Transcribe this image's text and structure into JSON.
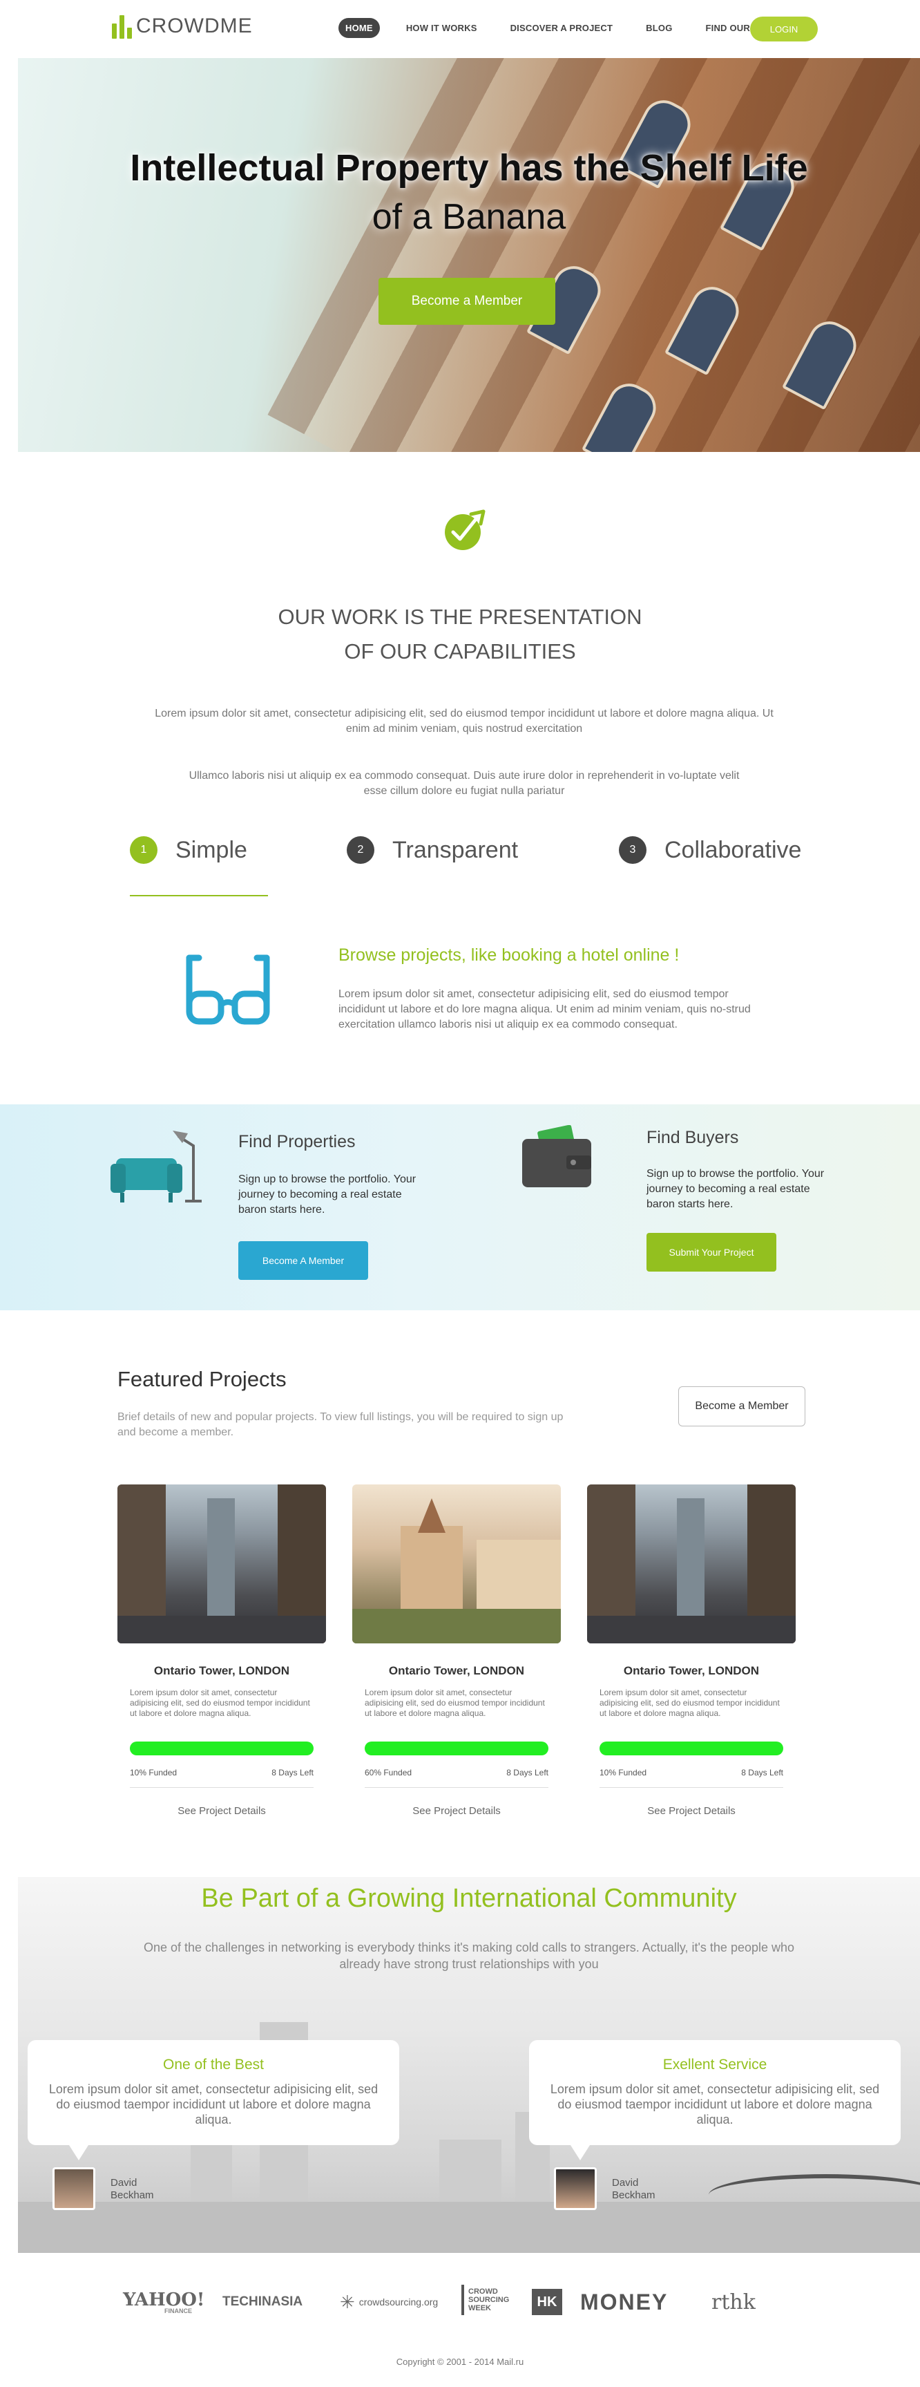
{
  "header": {
    "logo_text": "CROWDME",
    "nav": [
      "HOME",
      "HOW IT WORKS",
      "DISCOVER A PROJECT",
      "BLOG",
      "FIND OUR MORE"
    ],
    "login_label": "LOGIN"
  },
  "hero": {
    "title_line1": "Intellectual Property has the Shelf Life",
    "title_line2": "of a Banana",
    "cta_label": "Become a Member"
  },
  "work": {
    "title_line1": "OUR WORK IS THE PRESENTATION",
    "title_line2": "OF OUR CAPABILITIES",
    "paragraph1": "Lorem ipsum dolor sit amet, consectetur adipisicing elit, sed do eiusmod tempor incididunt ut labore et dolore magna aliqua. Ut enim ad minim veniam, quis nostrud exercitation",
    "paragraph2": "Ullamco laboris nisi ut aliquip ex ea commodo consequat. Duis aute irure dolor in reprehenderit in vo-luptate velit esse cillum dolore eu fugiat nulla pariatur",
    "steps": [
      {
        "num": "1",
        "label": "Simple",
        "color": "#93c01f"
      },
      {
        "num": "2",
        "label": "Transparent",
        "color": "#444444"
      },
      {
        "num": "3",
        "label": "Collaborative",
        "color": "#444444"
      }
    ],
    "browse_title": "Browse projects, like booking a hotel online !",
    "browse_text": "Lorem ipsum dolor sit amet, consectetur adipisicing elit, sed do eiusmod tempor incididunt ut labore et do lore magna aliqua. Ut enim ad minim veniam, quis no-strud exercitation ullamco laboris nisi ut aliquip ex ea commodo consequat."
  },
  "band": {
    "properties": {
      "title": "Find Properties",
      "text": "Sign up to browse the portfolio. Your journey to becoming a real estate baron starts here.",
      "button": "Become A Member"
    },
    "buyers": {
      "title": "Find Buyers",
      "text": "Sign up to browse the portfolio. Your journey to becoming a real estate baron starts here.",
      "button": "Submit Your Project"
    }
  },
  "featured": {
    "title": "Featured Projects",
    "description": "Brief details of new and popular projects. To view full listings, you will be required to sign up and become a member.",
    "button": "Become a Member",
    "projects": [
      {
        "title": "Ontario Tower, LONDON",
        "text": "Lorem ipsum dolor sit amet, consectetur adipisicing elit, sed do eiusmod tempor incididunt ut labore et dolore magna aliqua.",
        "funded": "10% Funded",
        "days": "8 Days Left",
        "link": "See Project Details",
        "progress": 1.0
      },
      {
        "title": "Ontario Tower, LONDON",
        "text": "Lorem ipsum dolor sit amet, consectetur adipisicing elit, sed do eiusmod tempor incididunt ut labore et dolore magna aliqua.",
        "funded": "60% Funded",
        "days": "8 Days Left",
        "link": "See Project Details",
        "progress": 1.0
      },
      {
        "title": "Ontario Tower, LONDON",
        "text": "Lorem ipsum dolor sit amet, consectetur adipisicing elit, sed do eiusmod tempor incididunt ut labore et dolore magna aliqua.",
        "funded": "10% Funded",
        "days": "8 Days Left",
        "link": "See Project Details",
        "progress": 1.0
      }
    ]
  },
  "community": {
    "title": "Be Part of a Growing International Community",
    "text": "One of the challenges in networking is everybody thinks it's making cold calls to strangers. Actually, it's the people who already have strong trust relationships with you",
    "testimonials": [
      {
        "title": "One of the Best",
        "text": "Lorem ipsum dolor sit amet, consectetur adipisicing elit, sed do eiusmod taempor incididunt ut labore et dolore magna aliqua.",
        "name": "David Beckham"
      },
      {
        "title": "Exellent Service",
        "text": "Lorem ipsum dolor sit amet, consectetur adipisicing elit, sed do eiusmod taempor incididunt ut labore et dolore magna aliqua.",
        "name": "David Beckham"
      }
    ]
  },
  "press": {
    "logos": [
      "YAHOO!",
      "FINANCE",
      "TECHINASIA",
      "crowdsourcing.org",
      "CROWD SOURCING WEEK",
      "HK",
      "MONEY",
      "rthk"
    ]
  },
  "footer": {
    "copyright": "Copyright © 2001 - 2014 Mail.ru"
  },
  "colors": {
    "accent": "#93c01f",
    "blue": "#2aa7d1",
    "dark": "#444444"
  }
}
